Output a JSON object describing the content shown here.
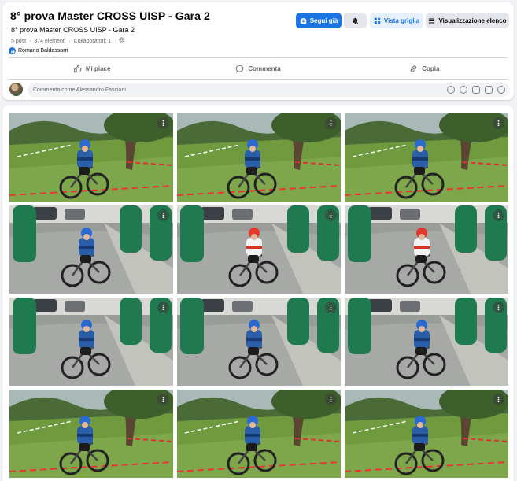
{
  "album": {
    "title": "8° prova Master CROSS UISP - Gara 2",
    "description": "8° prova Master CROSS UISP - Gara 2",
    "meta": [
      "5 post",
      "·",
      "374 elementi",
      "·",
      "Collaboratori: 1",
      "·"
    ],
    "contributor": "Romano Baldassarri"
  },
  "toolbar": {
    "follow_label": "Segui già",
    "grid_label": "Vista griglia",
    "list_label": "Visualizzazione elenco"
  },
  "actions": {
    "like_label": "Mi piace",
    "comment_label": "Commenta",
    "copy_label": "Copia"
  },
  "comment": {
    "placeholder": "Commenta come Alessandro Fasciani"
  },
  "colors": {
    "accent": "#1b74e4",
    "background": "#f0f2f5",
    "grass": "#6f9a3e",
    "inflatable": "#1f7a4f",
    "road": "#9a9c9a"
  },
  "photos": [
    {
      "scene": "grass",
      "rider": "blue"
    },
    {
      "scene": "grass",
      "rider": "blue"
    },
    {
      "scene": "grass",
      "rider": "blue"
    },
    {
      "scene": "road",
      "rider": "blue"
    },
    {
      "scene": "road",
      "rider": "red"
    },
    {
      "scene": "road",
      "rider": "red"
    },
    {
      "scene": "road",
      "rider": "blue"
    },
    {
      "scene": "road",
      "rider": "blue"
    },
    {
      "scene": "road",
      "rider": "blue"
    },
    {
      "scene": "grass",
      "rider": "blue"
    },
    {
      "scene": "grass",
      "rider": "blue"
    },
    {
      "scene": "grass",
      "rider": "blue"
    }
  ]
}
